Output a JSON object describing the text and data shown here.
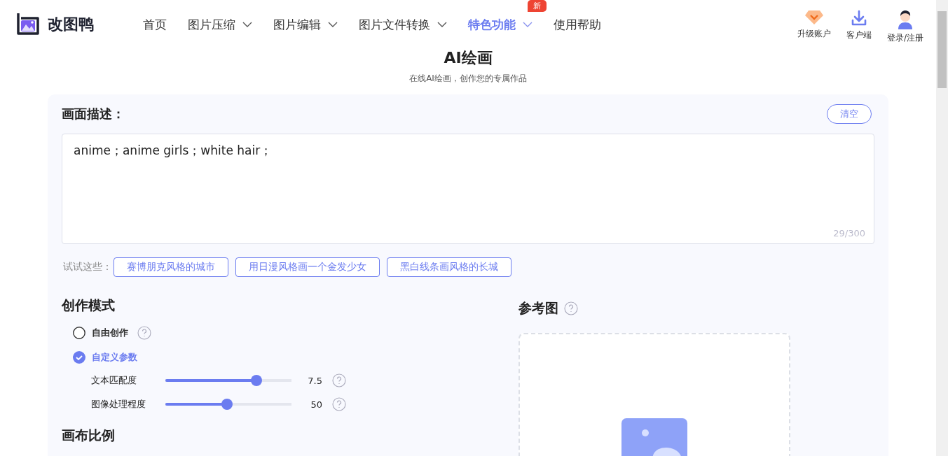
{
  "logo": {
    "name": "改图鸭"
  },
  "nav": [
    {
      "label": "首页",
      "dropdown": false,
      "selected": false
    },
    {
      "label": "图片压缩",
      "dropdown": true,
      "selected": false
    },
    {
      "label": "图片编辑",
      "dropdown": true,
      "selected": false
    },
    {
      "label": "图片文件转换",
      "dropdown": true,
      "selected": false
    },
    {
      "label": "特色功能",
      "dropdown": true,
      "selected": true,
      "badge": "新"
    },
    {
      "label": "使用帮助",
      "dropdown": false,
      "selected": false
    }
  ],
  "actions": [
    {
      "kind": "upgrade",
      "label": "升级账户"
    },
    {
      "kind": "download",
      "label": "客户端"
    },
    {
      "kind": "user",
      "label": "登录/注册"
    }
  ],
  "page": {
    "title": "AI绘画",
    "subtitle": "在线AI绘画，创作您的专属作品"
  },
  "description": {
    "label": "画面描述：",
    "clear_button": "清空",
    "value": "anime；anime girls；white hair；",
    "counter": "29/300"
  },
  "suggestions": {
    "label": "试试这些：",
    "items": [
      "赛博朋克风格的城市",
      "用日漫风格画一个金发少女",
      "黑白线条画风格的长城"
    ]
  },
  "mode": {
    "title": "创作模式",
    "options": [
      {
        "label": "自由创作",
        "selected": false,
        "help": true
      },
      {
        "label": "自定义参数",
        "selected": true,
        "help": false
      }
    ],
    "sliders": [
      {
        "label": "文本匹配度",
        "level": 0.72,
        "reading": "7.5"
      },
      {
        "label": "图像处理程度",
        "level": 0.49,
        "reading": "50"
      }
    ]
  },
  "canvas_ratio": {
    "title": "画布比例"
  },
  "reference": {
    "title": "参考图"
  }
}
